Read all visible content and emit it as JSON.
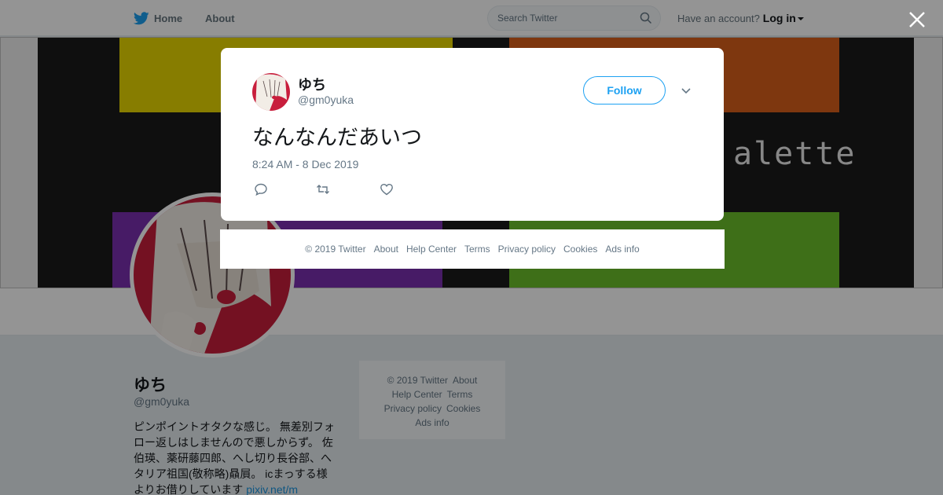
{
  "topbar": {
    "home_label": "Home",
    "about_label": "About",
    "search_placeholder": "Search Twitter",
    "account_prompt": "Have an account?",
    "login_label": "Log in"
  },
  "banner": {
    "text": "alette"
  },
  "profile": {
    "name": "ゆち",
    "handle": "@gm0yuka",
    "bio_lines": [
      "ピンポイントオタクな感じ。 無差別フォ",
      "ロー返しはしませんので悪しからず。 佐",
      "伯瑛、薬研藤四郎、へし切り長谷部、へ",
      "タリア祖国(敬称略)贔屓。 icまっする様",
      "よりお借りしています "
    ],
    "bio_link": "pixiv.net/m"
  },
  "side_footer": {
    "items": [
      "© 2019 Twitter",
      "About",
      "Help Center",
      "Terms",
      "Privacy policy",
      "Cookies",
      "Ads info"
    ]
  },
  "modal": {
    "name": "ゆち",
    "handle": "@gm0yuka",
    "follow_label": "Follow",
    "tweet_text": "なんなんだあいつ",
    "timestamp": "8:24 AM - 8 Dec 2019"
  },
  "modal_footer": {
    "items": [
      "© 2019 Twitter",
      "About",
      "Help Center",
      "Terms",
      "Privacy policy",
      "Cookies",
      "Ads info"
    ]
  },
  "colors": {
    "accent": "#1da1f2",
    "text_primary": "#14171a",
    "text_secondary": "#657786"
  },
  "icons": {
    "bird": "twitter-bird-icon",
    "search": "search-icon",
    "close": "close-icon",
    "chevron": "chevron-down-icon",
    "reply": "reply-icon",
    "retweet": "retweet-icon",
    "like": "heart-icon"
  }
}
